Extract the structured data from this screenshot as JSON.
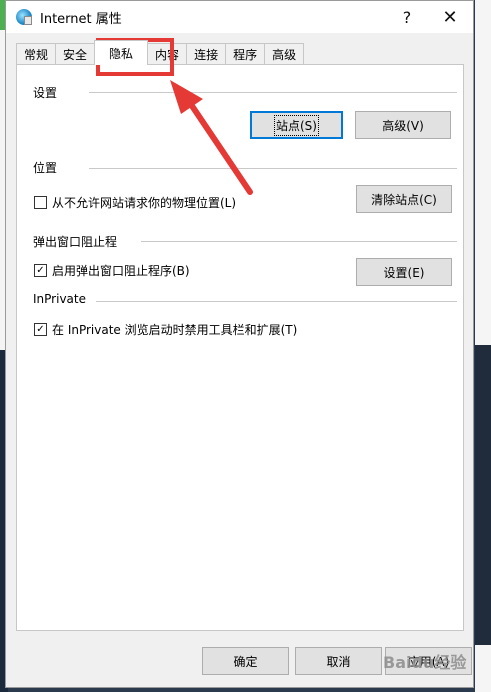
{
  "window": {
    "title": "Internet 属性",
    "help_label": "?",
    "close_label": "✕"
  },
  "tabs": [
    {
      "label": "常规"
    },
    {
      "label": "安全"
    },
    {
      "label": "隐私"
    },
    {
      "label": "内容"
    },
    {
      "label": "连接"
    },
    {
      "label": "程序"
    },
    {
      "label": "高级"
    }
  ],
  "active_tab": "隐私",
  "settings": {
    "heading": "设置",
    "sites_button": "站点(S)",
    "advanced_button": "高级(V)"
  },
  "location": {
    "heading": "位置",
    "checkbox_label": "从不允许网站请求你的物理位置(L)",
    "checked": false,
    "clear_sites_button": "清除站点(C)"
  },
  "popup_blocker": {
    "heading": "弹出窗口阻止程",
    "checkbox_label": "启用弹出窗口阻止程序(B)",
    "checked": true,
    "settings_button": "设置(E)"
  },
  "inprivate": {
    "heading": "InPrivate",
    "checkbox_label": "在 InPrivate 浏览启动时禁用工具栏和扩展(T)",
    "checked": true
  },
  "footer": {
    "ok_button": "确定",
    "cancel_button": "取消",
    "apply_button": "应用(A)"
  },
  "watermark": "Baidu经验",
  "colors": {
    "annotation": "#e53935",
    "focus": "#0078d7",
    "dialog_bg": "#f0f0f0",
    "panel_bg": "#ffffff"
  },
  "check_glyph": "✓"
}
